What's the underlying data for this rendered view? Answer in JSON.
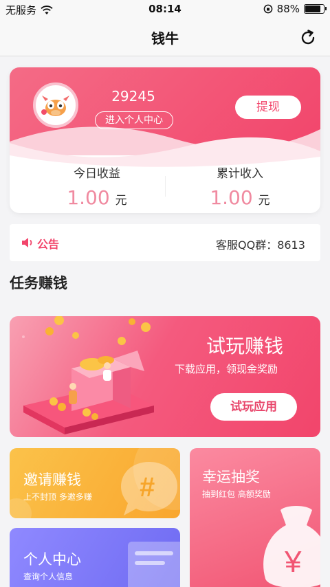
{
  "status_bar": {
    "carrier": "无服务",
    "time": "08:14",
    "battery_percent": "88%",
    "battery_level": 0.88
  },
  "nav": {
    "title": "钱牛"
  },
  "profile": {
    "user_id": "29245",
    "enter_center_label": "进入个人中心",
    "withdraw_label": "提现",
    "today_income_label": "今日收益",
    "today_income_value": "1.00",
    "today_income_unit": "元",
    "total_income_label": "累计收入",
    "total_income_value": "1.00",
    "total_income_unit": "元"
  },
  "notice": {
    "label": "公告",
    "text": "客服QQ群：8613"
  },
  "section": {
    "title": "任务赚钱"
  },
  "trial": {
    "title": "试玩赚钱",
    "subtitle": "下载应用，领现金奖励",
    "button_label": "试玩应用"
  },
  "invite": {
    "title": "邀请赚钱",
    "subtitle": "上不封顶 多邀多赚"
  },
  "lucky": {
    "title": "幸运抽奖",
    "subtitle": "抽到红包 高额奖励"
  },
  "center": {
    "title": "个人中心",
    "subtitle": "查询个人信息"
  },
  "colors": {
    "accent": "#f2456b",
    "invite": "#f9a62e",
    "center": "#6e6af2",
    "lucky": "#f15573"
  }
}
